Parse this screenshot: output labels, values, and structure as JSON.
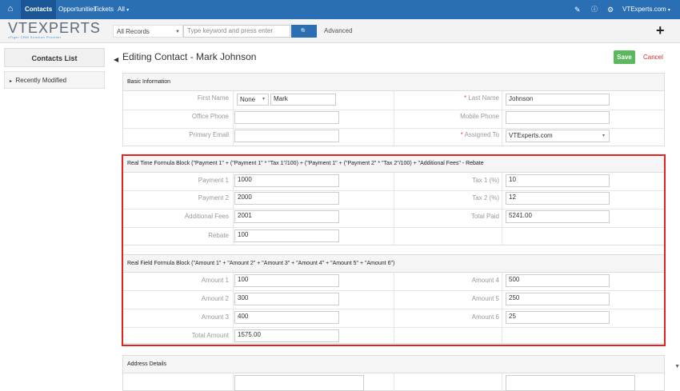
{
  "topbar": {
    "nav": [
      "Contacts",
      "Opportunities",
      "Tickets",
      "All"
    ],
    "user": "VTExperts.com"
  },
  "logo": {
    "brand": "VTEXPERTS",
    "tagline": "vTiger CRM Solution Provider"
  },
  "search": {
    "scope": "All Records",
    "placeholder": "Type keyword and press enter",
    "button": "🔍",
    "advanced": "Advanced"
  },
  "sidebar": {
    "title": "Contacts List",
    "items": [
      "Recently Modified"
    ]
  },
  "page": {
    "title": "Editing Contact - Mark Johnson",
    "save": "Save",
    "cancel": "Cancel"
  },
  "basic": {
    "heading": "Basic Information",
    "first_name_label": "First Name",
    "salutation": "None",
    "first_name": "Mark",
    "last_name_label": "Last Name",
    "last_name": "Johnson",
    "office_phone_label": "Office Phone",
    "mobile_phone_label": "Mobile Phone",
    "primary_email_label": "Primary Email",
    "assigned_to_label": "Assigned To",
    "assigned_to": "VTExperts.com"
  },
  "formula1": {
    "heading": "Real Time Formula Block (\"Payment 1\" + (\"Payment 1\" * \"Tax 1\"/100) + (\"Payment 1\" + (\"Payment 2\" * \"Tax 2\"/100) + \"Additional Fees\" - Rebate",
    "payment1_label": "Payment 1",
    "payment1": "1000",
    "tax1_label": "Tax 1 (%)",
    "tax1": "10",
    "payment2_label": "Payment 2",
    "payment2": "2000",
    "tax2_label": "Tax 2 (%)",
    "tax2": "12",
    "fees_label": "Additional Fees",
    "fees": "2001",
    "total_paid_label": "Total Paid",
    "total_paid": "5241.00",
    "rebate_label": "Rebate",
    "rebate": "100"
  },
  "formula2": {
    "heading": "Real Field Formula Block (\"Amount 1\" + \"Amount 2\" + \"Amount 3\" + \"Amount 4\" + \"Amount 5\" + \"Amount 6\")",
    "amount1_label": "Amount 1",
    "amount1": "100",
    "amount4_label": "Amount 4",
    "amount4": "500",
    "amount2_label": "Amount 2",
    "amount2": "300",
    "amount5_label": "Amount 5",
    "amount5": "250",
    "amount3_label": "Amount 3",
    "amount3": "400",
    "amount6_label": "Amount 6",
    "amount6": "25",
    "total_label": "Total Amount",
    "total": "1575.00"
  },
  "address": {
    "heading": "Address Details"
  }
}
